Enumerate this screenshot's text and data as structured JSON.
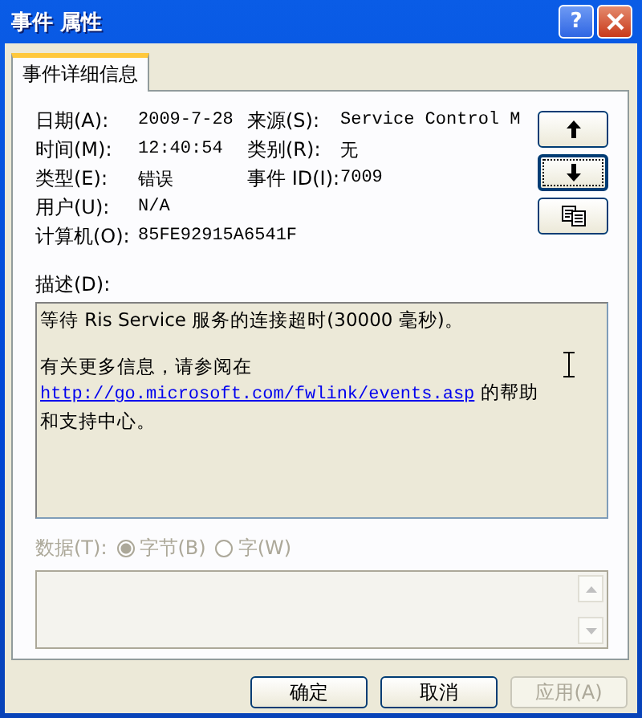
{
  "window": {
    "title": "事件 属性",
    "help_label": "?"
  },
  "tabs": [
    {
      "label": "事件详细信息",
      "selected": true
    }
  ],
  "fields": [
    {
      "label": "日期(A):",
      "value": "2009-7-28",
      "label2": "来源(S):",
      "value2": "Service Control M"
    },
    {
      "label": "时间(M):",
      "value": "12:40:54",
      "label2": "类别(R):",
      "value2": "无"
    },
    {
      "label": "类型(E):",
      "value": "错误",
      "label2": "事件 ID(I):",
      "value2": "7009"
    },
    {
      "label": "用户(U):",
      "value": "N/A"
    },
    {
      "label": "计算机(O):",
      "value": "85FE92915A6541F"
    }
  ],
  "side_buttons": [
    {
      "kind": "up",
      "focused": false
    },
    {
      "kind": "down",
      "focused": true
    },
    {
      "kind": "copy",
      "focused": false
    }
  ],
  "description": {
    "label": "描述(D):",
    "line1": "等待 Ris Service 服务的连接超时(30000 毫秒)。",
    "before": "有关更多信息，请参阅在",
    "link": "http://go.microsoft.com/fwlink/events.asp",
    "after": "的帮助和支持中心。"
  },
  "data": {
    "label": "数据(T):",
    "disabled": true,
    "radios": [
      {
        "label": "字节(B)",
        "selected": true
      },
      {
        "label": "字(W)",
        "selected": false
      }
    ]
  },
  "buttons": [
    {
      "label": "确定",
      "disabled": false
    },
    {
      "label": "取消",
      "disabled": false
    },
    {
      "label": "应用(A)",
      "disabled": true
    }
  ]
}
